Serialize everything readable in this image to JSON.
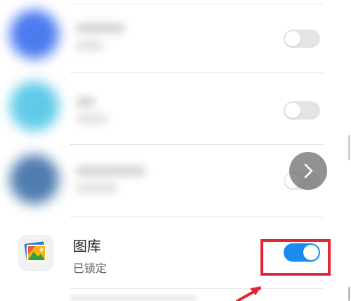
{
  "apps": [
    {
      "toggle_on": false
    },
    {
      "toggle_on": false
    },
    {
      "toggle_on": false
    },
    {
      "name": "图库",
      "status": "已锁定",
      "toggle_on": true,
      "highlighted": true
    }
  ],
  "colors": {
    "toggle_on": "#1a8cf0",
    "toggle_off": "#e4e4e4",
    "highlight": "#e32636"
  },
  "icons": {
    "next": "chevron-right-icon",
    "gallery": "gallery-icon",
    "annotation": "red-arrow-icon"
  }
}
